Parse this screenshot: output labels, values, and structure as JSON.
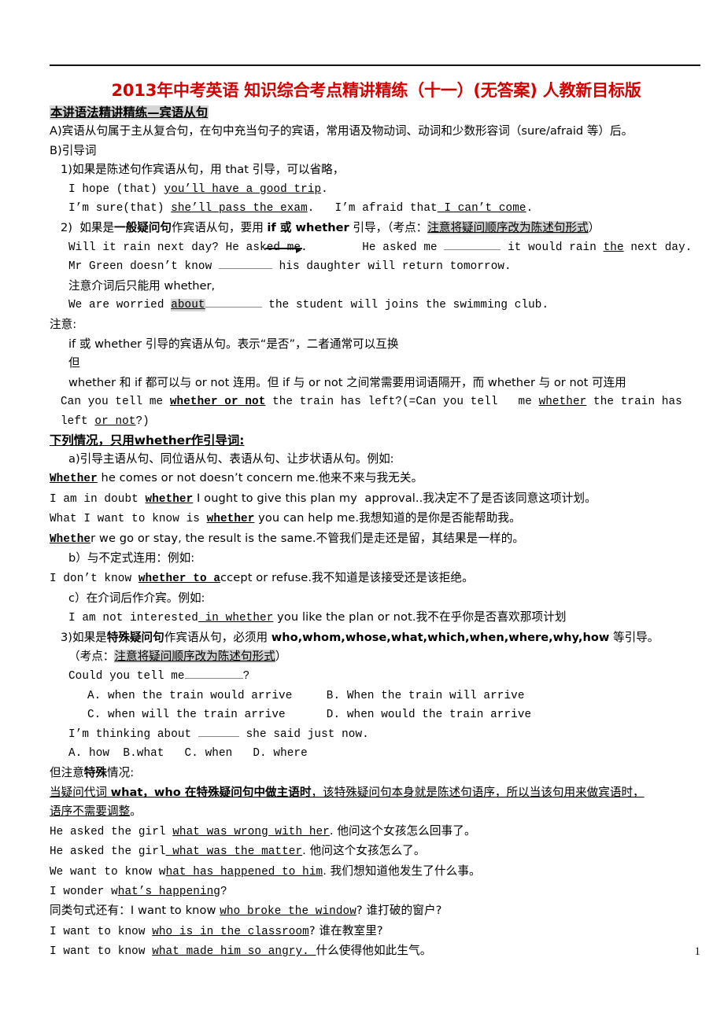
{
  "document": {
    "title": "2013年中考英语 知识综合考点精讲精练（十一）(无答案)  人教新目标版",
    "section_heading": "本讲语法精讲精练—宾语从句",
    "page_number": "1",
    "title_color": "#d70000",
    "highlight_color": "#d5d5d5"
  },
  "body": {
    "line_A": "A)宾语从句属于主从复合句，在句中充当句子的宾语，常用语及物动词、动词和少数形容词（sure/afraid 等）后。",
    "line_B": "B)引导词",
    "item1": "1)如果是陈述句作宾语从句，用 that 引导，可以省略，",
    "item1_bold": "陈述句",
    "example1": "I hope (that) you’ll have a good trip.",
    "example1_underlined": "you’ll have a good trip",
    "example2a": "I’m sure(that) ",
    "example2a_underlined": "she’ll pass the exam",
    "example2b": ".   I’m afraid that",
    "example2b_underlined": " I can’t come",
    "example2_end": ".",
    "item2_pre": "2)  如果是",
    "item2_bold1": "一般疑问句",
    "item2_mid": "作宾语从句，要用 ",
    "item2_bold2": "if 或 whether",
    "item2_post": " 引导，（考点：",
    "item2_highlight": "注意将疑问顺序改为陈述句形式",
    "item2_end": "）",
    "q1_a": "Will it rain next day? He ask",
    "q1_strike": "ed me",
    "q1_b": ".",
    "q1_c": "He asked me ",
    "q1_d": " it would rain ",
    "q1_the": "the",
    "q1_e": " next day.",
    "q2_a": "Mr Green doesn’t know ",
    "q2_b": " his daughter will return tomorrow.",
    "note_prep": "注意介词后只能用 whether,",
    "q3_a": "We are worried ",
    "q3_about": "about",
    "q3_b": " the student will joins the swimming club.",
    "note_label": "注意:",
    "note1": "if 或 whether 引导的宾语从句。表示“是否”，二者通常可以互换",
    "note2": "但",
    "note3": "whether 和 if 都可以与 or not 连用。但 if 与 or not 之间常需要用词语隔开，而 whether 与 or not 可连用",
    "note4_a": "Can you tell me ",
    "note4_bold": "whether or not",
    "note4_b": " the train has left?(=Can you tell   me ",
    "note4_u1": "whether",
    "note4_c": " the train has left ",
    "note4_u2": "or not",
    "note4_d": "?)",
    "whether_heading": "下列情况，只用whether作引导词:",
    "wa": "a)引导主语从句、同位语从句、表语从句、让步状语从句。例如:",
    "wa_ex1_u": "Whether",
    "wa_ex1": " he comes or not doesn’t concern me.他来不来与我无关。",
    "wa_ex2_a": "I am in doubt ",
    "wa_ex2_b": "whether",
    "wa_ex2_c": " I ought to give this plan my  approval..我决定不了是否该同意这项计划。",
    "wa_ex3_a": "What I want to know is ",
    "wa_ex3_b": "whether",
    "wa_ex3_c": " you can help me.我想知道的是你是否能帮助我。",
    "wa_ex4_u": "Whethe",
    "wa_ex4": "r we go or stay, the result is the same.不管我们是走还是留，其结果是一样的。",
    "wb": "b）与不定式连用：例如:",
    "wb_ex_a": "I don’t know ",
    "wb_ex_b": "whether to a",
    "wb_ex_c": "ccept or refuse.我不知道是该接受还是该拒绝。",
    "wc": "c）在介词后作介宾。例如:",
    "wc_ex_a": "I am not interested",
    "wc_ex_u": " in whether",
    "wc_ex_b": " you like the plan or not.我不在乎你是否喜欢那项计划",
    "item3_pre": "3)如果是",
    "item3_bold1": "特殊疑问句",
    "item3_mid": "作宾语从句，必须用 ",
    "item3_bold2": "who,whom,whose,what,which,when,where,why,how",
    "item3_post": " 等引导。",
    "item3_kaodian_pre": "（考点：",
    "item3_highlight": "注意将疑问顺序改为陈述句形式",
    "item3_kaodian_post": "）",
    "mcq1_stem_a": "Could you tell me",
    "mcq1_stem_b": "?",
    "mcq1_optA": "A. when the train would arrive",
    "mcq1_optB": "B. When the train will arrive",
    "mcq1_optC": "C. when will the train arrive",
    "mcq1_optD": "D. when would the train arrive",
    "mcq2_stem_a": "I’m thinking about ",
    "mcq2_stem_b": " she said just now.",
    "mcq2_opts": "A. how  B.what   C. when   D. where",
    "special_pre": "但注意",
    "special_bold": "特殊",
    "special_post": "情况:",
    "special_line1_a": "当疑问代词 ",
    "special_line1_b": "what，who 在特殊疑问句中做主语时",
    "special_line1_c": "，该特殊疑问句本身就是陈述句语序，所以当该句用来做宾语时，",
    "special_line2": "语序不需要调整",
    "special_line2_end": "。",
    "ex_a1": "He asked the girl ",
    "ex_a1_u": "what was wrong with her",
    "ex_a1_end": ". 他问这个女孩怎么回事了。",
    "ex_a2": "He asked the girl",
    "ex_a2_u": " what was the matter",
    "ex_a2_end": ". 他问这个女孩怎么了。",
    "ex_a3": "We want to know w",
    "ex_a3_u": "hat has happened to him",
    "ex_a3_end": ". 我们想知道他发生了什么事。",
    "ex_a4": "I wonder w",
    "ex_a4_u": "hat’s happening",
    "ex_a4_end": "?",
    "ex_a5": "同类句式还有：I want to know ",
    "ex_a5_u": "who broke the window",
    "ex_a5_end": "? 谁打破的窗户?",
    "ex_a6": "I want to know ",
    "ex_a6_u": "who is in the classroom",
    "ex_a6_end": "? 谁在教室里?",
    "ex_a7": "I want to know ",
    "ex_a7_u": "what made him so angry. ",
    "ex_a7_end": "什么使得他如此生气。"
  }
}
